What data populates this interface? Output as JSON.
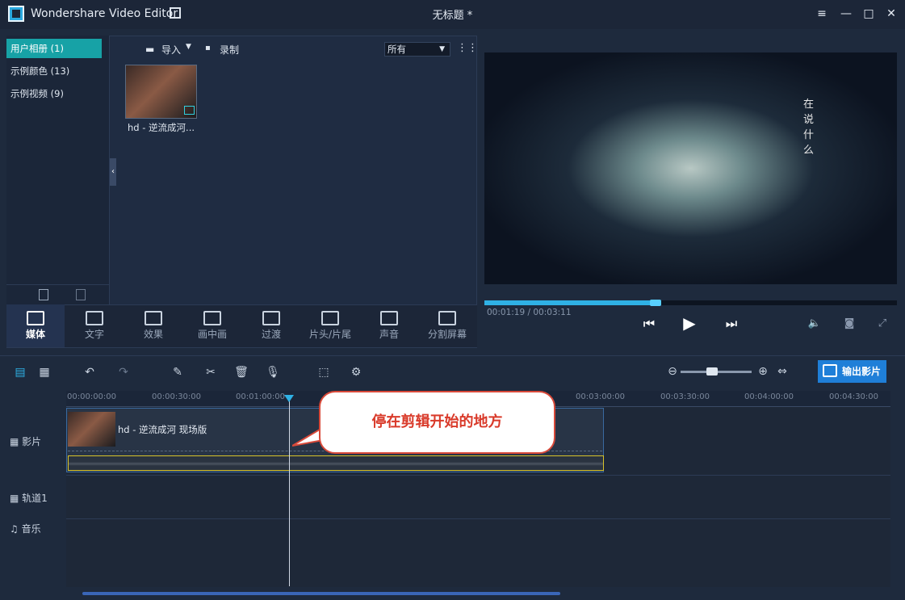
{
  "app": {
    "title": "Wondershare Video Editor",
    "doc_title": "无标题 *"
  },
  "window_controls": {
    "menu": "≡",
    "minimize": "—",
    "maximize": "□",
    "close": "✕"
  },
  "albums": [
    {
      "label": "用户相册 (1)",
      "selected": true
    },
    {
      "label": "示例颜色 (13)",
      "selected": false
    },
    {
      "label": "示例视频 (9)",
      "selected": false
    }
  ],
  "media_toolbar": {
    "import_label": "导入",
    "record_label": "录制",
    "filter_value": "所有"
  },
  "media_items": [
    {
      "label": "hd - 逆流成河..."
    }
  ],
  "tabs": [
    {
      "label": "媒体",
      "icon": "media-icon",
      "selected": true
    },
    {
      "label": "文字",
      "icon": "text-icon",
      "selected": false
    },
    {
      "label": "效果",
      "icon": "effects-icon",
      "selected": false
    },
    {
      "label": "画中画",
      "icon": "pip-icon",
      "selected": false
    },
    {
      "label": "过渡",
      "icon": "transition-icon",
      "selected": false
    },
    {
      "label": "片头/片尾",
      "icon": "intro-credit-icon",
      "selected": false
    },
    {
      "label": "声音",
      "icon": "sound-icon",
      "selected": false
    },
    {
      "label": "分割屏幕",
      "icon": "split-screen-icon",
      "selected": false
    }
  ],
  "preview": {
    "caption": "在说什么",
    "timecode": "00:01:19 / 00:03:11",
    "progress": 0.41
  },
  "export": {
    "label": "输出影片"
  },
  "timeline": {
    "ticks": [
      "00:00:00:00",
      "00:00:30:00",
      "00:01:00:00",
      "00:03:00:00",
      "00:03:30:00",
      "00:04:00:00",
      "00:04:30:00"
    ],
    "tracks": [
      {
        "label": "影片"
      },
      {
        "label": "轨道1"
      },
      {
        "label": "音乐"
      }
    ],
    "clip_title": "hd - 逆流成河 现场版"
  },
  "callout": {
    "text": "停在剪辑开始的地方"
  },
  "colors": {
    "accent": "#17a2a6",
    "progress": "#2fb1e5",
    "export": "#1f7fd8",
    "callout_border": "#d94a3a"
  }
}
